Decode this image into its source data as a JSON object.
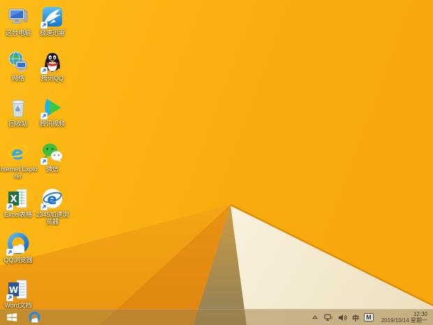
{
  "desktop": {
    "wallpaper_colors": {
      "amber_base": "#f9ab0e",
      "amber_light": "#fcba16",
      "facet_left": "#f3a213",
      "facet_wedge": "#e79012",
      "shadow_tan": "#8f7f58",
      "cream": "#f5eed7",
      "ridge": "#e08a06"
    },
    "icons": [
      {
        "label": "这台电脑",
        "icon": "this-pc-icon",
        "shortcut": false
      },
      {
        "label": "极速迅雷",
        "icon": "xunlei-icon",
        "shortcut": true
      },
      {
        "label": "网络",
        "icon": "network-globe-icon",
        "shortcut": false
      },
      {
        "label": "腾讯QQ",
        "icon": "qq-penguin-icon",
        "shortcut": true
      },
      {
        "label": "回收站",
        "icon": "recycle-bin-icon",
        "shortcut": false
      },
      {
        "label": "腾讯视频",
        "icon": "tencent-video-icon",
        "shortcut": true
      },
      {
        "label": "Internet Explorer",
        "icon": "internet-explorer-icon",
        "shortcut": false
      },
      {
        "label": "微信",
        "icon": "wechat-icon",
        "shortcut": true
      },
      {
        "label": "Excel表格",
        "icon": "excel-icon",
        "shortcut": true
      },
      {
        "label": "2345加速浏览器",
        "icon": "browser-2345-icon",
        "shortcut": true
      },
      {
        "label": "QQ浏览器",
        "icon": "qq-browser-icon",
        "shortcut": true
      },
      {
        "label": "Word文档",
        "icon": "word-icon",
        "shortcut": true
      }
    ]
  },
  "taskbar": {
    "pinned": [
      {
        "icon": "qq-browser-icon"
      }
    ],
    "tray": {
      "ime_lang": "中",
      "ime_mode": "M",
      "time": "12:30",
      "date": "2019/10/14 星期一"
    }
  }
}
